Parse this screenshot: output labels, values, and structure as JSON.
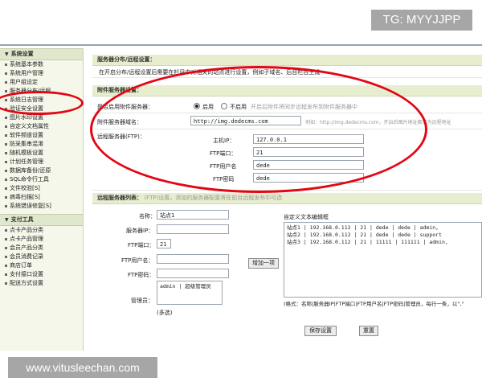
{
  "watermark_top": "TG: MYYJJPP",
  "watermark_bottom": "www.vitusleechan.com",
  "colors": {
    "annotation": "#e30613",
    "sidebar_bg": "#f4f7ea",
    "header_bg": "#e6eecf"
  },
  "sidebar": {
    "group1": {
      "title": "系统设置",
      "items": [
        "系统基本参数",
        "系统用户管理",
        "用户组设定",
        "服务器分布/远程",
        "系统日志管理",
        "验证安全设置",
        "图片水印设置",
        "自定义文档属性",
        "软件频道设置",
        "防采集串混淆",
        "随机模板设置",
        "计划任务管理",
        "数据库备份/还原",
        "SQL命令行工具",
        "文件校验[S]",
        "病毒扫描[S]",
        "系统错误修复[S]"
      ]
    },
    "group2": {
      "title": "支付工具",
      "items": [
        "点卡产品分类",
        "点卡产品管理",
        "会员产品分类",
        "会员消费记录",
        "商店订单",
        "支付接口设置",
        "配送方式设置"
      ]
    }
  },
  "main": {
    "header1": "服务器分布/远程设置：",
    "description": "在开启分布/远程设置后需要在栏目中对相关的站点进行设置，例如子域名、后台栏目生成",
    "attach_header": "附件服务器设置：",
    "enable_label": "是否启用附件服务器：",
    "enable_opt_on": "启用",
    "enable_opt_off": "不启用",
    "enable_hint": "开启后附件将同步远程发布到附件服务器中",
    "domain_label": "附件服务器域名：",
    "domain_value": "http://img.dedecms.com",
    "domain_hint": "例如：http://img.dedecms.com，开启后图片地址都变为远程地址",
    "ftp_label": "远程服务器(FTP)：",
    "host_label": "主机IP：",
    "host_value": "127.0.0.1",
    "port_label": "FTP端口：",
    "port_value": "21",
    "user_label": "FTP用户名",
    "user_value": "dede",
    "pass_label": "FTP密码",
    "pass_value": "dede",
    "list_header": "远程服务器列表：",
    "list_hint": "(FTP)设置，添加的服务器配置将在前台远程发布中可选",
    "name_label": "名称：",
    "name_value": "站点1",
    "ip_label": "服务器IP：",
    "ip_value": "",
    "fport_label": "FTP端口：",
    "fport_value": "21",
    "fuser_label": "FTP用户名：",
    "fuser_value": "",
    "fpass_label": "FTP密码：",
    "fpass_value": "",
    "admin_label": "管理员：",
    "admin_value": "admin | 超级管理员",
    "multi_label": "(多选)",
    "add_button": "增加一项",
    "editor_label": "自定义文本编辑框",
    "editor_value": "站点1 | 192.168.0.112 | 21 | dede | dede | admin,\n站点2 | 192.168.0.112 | 21 | dede | dede | support\n站点3 | 192.168.0.112 | 21 | 11111 | 111111 | admin,",
    "format_hint": "(格式：名称|服务器IP|FTP端口|FTP用户名|FTP密码|管理员，每行一条，以\",\"",
    "save_button": "保存设置",
    "reset_button": "重置"
  }
}
